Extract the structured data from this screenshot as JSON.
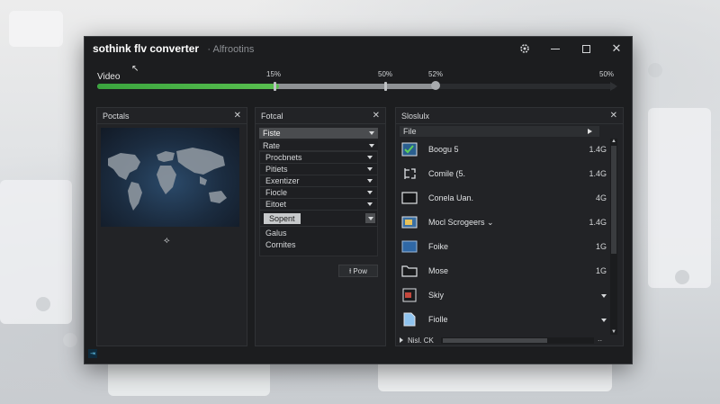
{
  "app": {
    "brand": "sothink flv converter",
    "subtitle": "· Alfrootins"
  },
  "window_controls": [
    "minimize",
    "maximize",
    "close"
  ],
  "video": {
    "label": "Video",
    "marks": [
      "15%",
      "50%",
      "52%",
      "50%"
    ],
    "progress_fraction": 0.35,
    "buffered_fraction": 0.66
  },
  "preview_panel": {
    "title": "Poctals"
  },
  "format_panel": {
    "title": "Fotcal",
    "selects": [
      "Fiste",
      "Rate"
    ],
    "items": [
      "Procbnets",
      "Pitiets",
      "Exentizer",
      "Fiocle",
      "Eitoet"
    ],
    "selected_item": "Sopent",
    "extra_items": [
      "Galus",
      "Cornites"
    ],
    "button_label": "Ɨ Pow"
  },
  "files_panel": {
    "title": "Sloslulx",
    "column_header": "File",
    "files": [
      {
        "name": "Boogu 5",
        "size": "1.4G",
        "icon": "checked-image-icon",
        "caret": false
      },
      {
        "name": "Comile (5.",
        "size": "1.4G",
        "icon": "split-icon",
        "caret": false
      },
      {
        "name": "Conela Uan.",
        "size": "4G",
        "icon": "blank-frame-icon",
        "caret": false
      },
      {
        "name": "Mocl Scrogeers ⌄",
        "size": "1.4G",
        "icon": "image-icon",
        "caret": false
      },
      {
        "name": "Foike",
        "size": "1G",
        "icon": "blue-file-icon",
        "caret": false
      },
      {
        "name": "Mose",
        "size": "1G",
        "icon": "folder-icon",
        "caret": false
      },
      {
        "name": "Skiy",
        "size": "",
        "icon": "slide-icon",
        "caret": true
      },
      {
        "name": "Fiolle",
        "size": "",
        "icon": "document-icon",
        "caret": true
      }
    ],
    "footer_label": "Nisl. CK",
    "footer_more": "··"
  },
  "colors": {
    "window_bg": "#1c1d1f",
    "progress_green": "#4cb847",
    "accent_blue": "#3d7fc1"
  }
}
